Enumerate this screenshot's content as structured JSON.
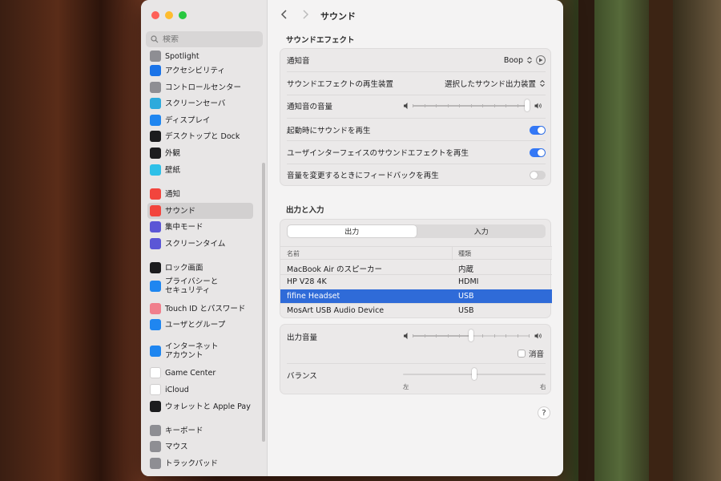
{
  "window": {
    "title": "サウンド"
  },
  "sidebar": {
    "search_placeholder": "検索",
    "items": [
      {
        "label": "Spotlight",
        "icon": "spotlight-icon",
        "color": "#8e8e93"
      },
      {
        "label": "アクセシビリティ",
        "icon": "accessibility-icon",
        "color": "#1a73e8"
      },
      {
        "label": "コントロールセンター",
        "icon": "control-center-icon",
        "color": "#8e8e93"
      },
      {
        "label": "スクリーンセーバ",
        "icon": "screensaver-icon",
        "color": "#2eaadc"
      },
      {
        "label": "ディスプレイ",
        "icon": "display-icon",
        "color": "#1f86f0"
      },
      {
        "label": "デスクトップと Dock",
        "icon": "desktop-dock-icon",
        "color": "#1c1c1e"
      },
      {
        "label": "外観",
        "icon": "appearance-icon",
        "color": "#1c1c1e"
      },
      {
        "label": "壁紙",
        "icon": "wallpaper-icon",
        "color": "#2ec0e8"
      },
      {
        "label": "通知",
        "icon": "notifications-icon",
        "color": "#f2453d"
      },
      {
        "label": "サウンド",
        "icon": "sound-icon",
        "color": "#f2453d",
        "active": true
      },
      {
        "label": "集中モード",
        "icon": "focus-icon",
        "color": "#5b56d6"
      },
      {
        "label": "スクリーンタイム",
        "icon": "screen-time-icon",
        "color": "#5b56d6"
      },
      {
        "label": "ロック画面",
        "icon": "lock-screen-icon",
        "color": "#1c1c1e"
      },
      {
        "label": "プライバシーと\nセキュリティ",
        "icon": "privacy-hand-icon",
        "color": "#1f86f0"
      },
      {
        "label": "Touch ID とパスワード",
        "icon": "touch-id-icon",
        "color": "#f07f8c"
      },
      {
        "label": "ユーザとグループ",
        "icon": "users-groups-icon",
        "color": "#1f86f0"
      },
      {
        "label": "インターネット\nアカウント",
        "icon": "internet-accounts-icon",
        "color": "#1f86f0"
      },
      {
        "label": "Game Center",
        "icon": "game-center-icon",
        "color": "#ffffff"
      },
      {
        "label": "iCloud",
        "icon": "icloud-icon",
        "color": "#ffffff"
      },
      {
        "label": "ウォレットと Apple Pay",
        "icon": "wallet-icon",
        "color": "#1c1c1e"
      },
      {
        "label": "キーボード",
        "icon": "keyboard-icon",
        "color": "#8e8e93"
      },
      {
        "label": "マウス",
        "icon": "mouse-icon",
        "color": "#8e8e93"
      },
      {
        "label": "トラックパッド",
        "icon": "trackpad-icon",
        "color": "#8e8e93"
      }
    ]
  },
  "sound_effects": {
    "section_title": "サウンドエフェクト",
    "alert_sound_label": "通知音",
    "alert_sound_value": "Boop",
    "output_device_label": "サウンドエフェクトの再生装置",
    "output_device_value": "選択したサウンド出力装置",
    "alert_volume_label": "通知音の音量",
    "alert_volume_level": 1.0,
    "startup_label": "起動時にサウンドを再生",
    "startup_on": true,
    "ui_effects_label": "ユーザインターフェイスのサウンドエフェクトを再生",
    "ui_effects_on": true,
    "feedback_label": "音量を変更するときにフィードバックを再生",
    "feedback_on": false
  },
  "io": {
    "section_title": "出力と入力",
    "tabs": [
      {
        "label": "出力",
        "active": true
      },
      {
        "label": "入力",
        "active": false
      }
    ],
    "columns": [
      "名前",
      "種類"
    ],
    "devices": [
      {
        "name": "MacBook Air のスピーカー",
        "type": "内蔵",
        "selected": false
      },
      {
        "name": "HP V28 4K",
        "type": "HDMI",
        "selected": false
      },
      {
        "name": "fifine Headset",
        "type": "USB",
        "selected": true
      },
      {
        "name": "MosArt USB Audio Device",
        "type": "USB",
        "selected": false
      }
    ],
    "output_volume_label": "出力音量",
    "output_volume_level": 0.5,
    "mute_label": "消音",
    "mute_checked": false,
    "balance_label": "バランス",
    "balance_level": 0.5,
    "balance_left_label": "左",
    "balance_right_label": "右"
  },
  "help_label": "?",
  "accent_color": "#3478f6",
  "selection_color": "#2f6bd8"
}
